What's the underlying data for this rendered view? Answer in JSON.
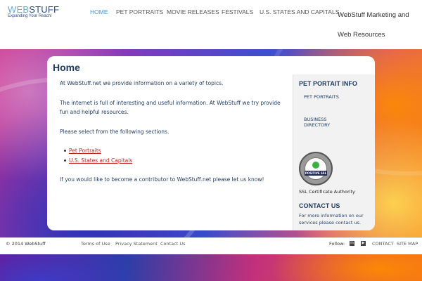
{
  "brand": {
    "name_part1": "WEB",
    "name_part2": "STUFF",
    "tagline": "Expanding Your Reach!"
  },
  "nav": {
    "items": [
      {
        "label": "HOME",
        "active": true
      },
      {
        "label": "PET PORTRAITS",
        "active": false
      },
      {
        "label": "MOVIE RELEASES",
        "active": false
      },
      {
        "label": "FESTIVALS",
        "active": false
      },
      {
        "label": "U.S. STATES AND CAPITALS",
        "active": false
      }
    ],
    "marketing": "WebStuff Marketing and Web Resources"
  },
  "main": {
    "title": "Home",
    "intro": "At WebStuff.net we provide information on a variety of topics.",
    "para2": "The internet is full of interesting and useful information. At WebStuff we try provide fun and helpful resources.",
    "para3": "Please select from the following sections.",
    "links": [
      "Pet Portraits",
      "U.S. States and Capitals"
    ],
    "contributor": "If you would like to become a contributor to WebStuff.net please let us know!"
  },
  "sidebar": {
    "heading": "PET PORTAIT INFO",
    "links": [
      "PET PORTRAITS",
      "BUSINESS DIRECTORY"
    ],
    "ssl_badge_word": "POSITIVE SSL",
    "ssl_caption": "SSL Certificate Authority",
    "contact_heading": "CONTACT US",
    "contact_text": "For more information on our services please contact us."
  },
  "footer": {
    "copyright": "© 2014 WebStuff",
    "links": [
      "Terms of Use",
      "Privacy Statement",
      "Contact Us"
    ],
    "follow_label": "Follow:",
    "social_icons": [
      "linkedin-icon",
      "youtube-icon"
    ],
    "right_links": [
      "CONTACT",
      "SITE MAP"
    ]
  },
  "colors": {
    "accent": "#3a9ad9",
    "heading": "#1e3a5f",
    "link": "#c0251b"
  }
}
